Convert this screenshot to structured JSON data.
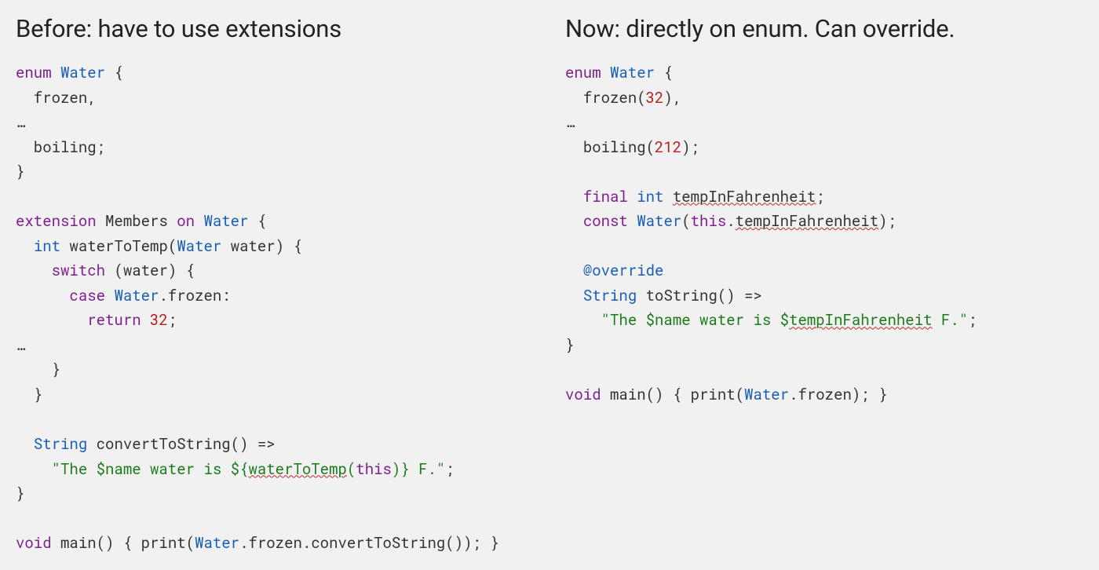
{
  "left": {
    "heading": "Before: have to use extensions",
    "code": {
      "l1": {
        "kw": "enum",
        "type": "Water",
        "brace": " {"
      },
      "l2": "  frozen,",
      "l3": "…",
      "l4": "  boiling;",
      "l5": "}",
      "l6": "",
      "l7": {
        "kw": "extension",
        "name": " Members ",
        "on": "on",
        "type": "Water",
        "brace": " {"
      },
      "l8": {
        "indent": "  ",
        "ret": "int",
        "name": " waterToTemp(",
        "ptype": "Water",
        "rest": " water) {"
      },
      "l9": {
        "indent": "    ",
        "kw": "switch",
        "rest": " (water) {"
      },
      "l10": {
        "indent": "      ",
        "kw": "case",
        "type": "Water",
        "dot": ".",
        "member": "frozen:",
        "rest": ""
      },
      "l11": {
        "indent": "        ",
        "kw": "return",
        "num": "32",
        "semi": ";"
      },
      "l12": "…",
      "l13": "    }",
      "l14": "  }",
      "l15": "",
      "l16": {
        "indent": "  ",
        "ret": "String",
        "name": " convertToString() =>"
      },
      "l17": {
        "indent": "    ",
        "q": "\"",
        "s1": "The $name water is ${",
        "squig": "waterToTemp",
        "s2": "(",
        "kw": "this",
        "s3": ")} F.\"",
        "semi": ";"
      },
      "l18": "}",
      "l19": "",
      "l20": {
        "kw": "void",
        "name": " main() { print(",
        "type": "Water",
        "rest": ".frozen.convertToString()); }"
      }
    }
  },
  "right": {
    "heading": "Now: directly on enum. Can override.",
    "code": {
      "l1": {
        "kw": "enum",
        "type": "Water",
        "brace": " {"
      },
      "l2": {
        "indent": "  ",
        "name": "frozen(",
        "num": "32",
        "rest": "),"
      },
      "l3": "…",
      "l4": {
        "indent": "  ",
        "name": "boiling(",
        "num": "212",
        "rest": ");"
      },
      "l5": "",
      "l6": {
        "indent": "  ",
        "kw": "final",
        "type": "int",
        "squig": "tempInFahrenheit",
        "semi": ";"
      },
      "l7": {
        "indent": "  ",
        "kw": "const",
        "type": "Water",
        "open": "(",
        "th": "this",
        "dot": ".",
        "squig": "tempInFahrenheit",
        "rest": ");"
      },
      "l8": "",
      "l9": {
        "indent": "  ",
        "ann": "@override"
      },
      "l10": {
        "indent": "  ",
        "ret": "String",
        "name": " toString() =>"
      },
      "l11": {
        "indent": "    ",
        "q": "\"",
        "s1": "The $name water is $",
        "squig": "tempInFahrenheit",
        "s2": " F.\"",
        "semi": ";"
      },
      "l12": "}",
      "l13": "",
      "l14": {
        "kw": "void",
        "name": " main() { print(",
        "type": "Water",
        "rest": ".frozen); }"
      }
    }
  }
}
